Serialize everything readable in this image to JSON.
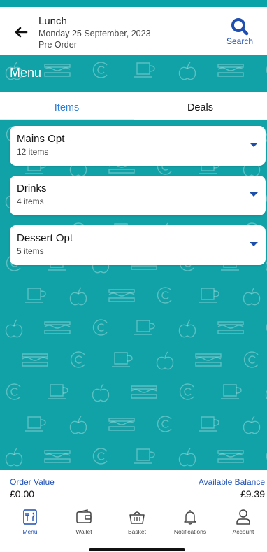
{
  "header": {
    "title": "Lunch",
    "date": "Monday 25 September, 2023",
    "subtitle": "Pre Order",
    "search_label": "Search",
    "back_icon": "arrow-left-icon",
    "search_icon": "search-icon"
  },
  "section": {
    "title": "Menu"
  },
  "tabs": [
    {
      "label": "Items",
      "active": true
    },
    {
      "label": "Deals",
      "active": false
    }
  ],
  "categories": [
    {
      "name": "Mains Opt",
      "count": "12 items"
    },
    {
      "name": "Drinks",
      "count": "4 items"
    },
    {
      "name": "Dessert Opt",
      "count": "5 items"
    }
  ],
  "footer": {
    "order_value_label": "Order Value",
    "order_value": "£0.00",
    "balance_label": "Available Balance",
    "balance": "£9.39"
  },
  "nav": [
    {
      "label": "Menu",
      "icon": "menu-book-icon",
      "active": true
    },
    {
      "label": "Wallet",
      "icon": "wallet-icon",
      "active": false
    },
    {
      "label": "Basket",
      "icon": "basket-icon",
      "active": false
    },
    {
      "label": "Notifications",
      "icon": "bell-icon",
      "active": false
    },
    {
      "label": "Account",
      "icon": "person-icon",
      "active": false
    }
  ],
  "colors": {
    "accent_teal": "#10a2a7",
    "link_blue": "#1f4fb0",
    "tab_blue": "#2e7fd6"
  }
}
